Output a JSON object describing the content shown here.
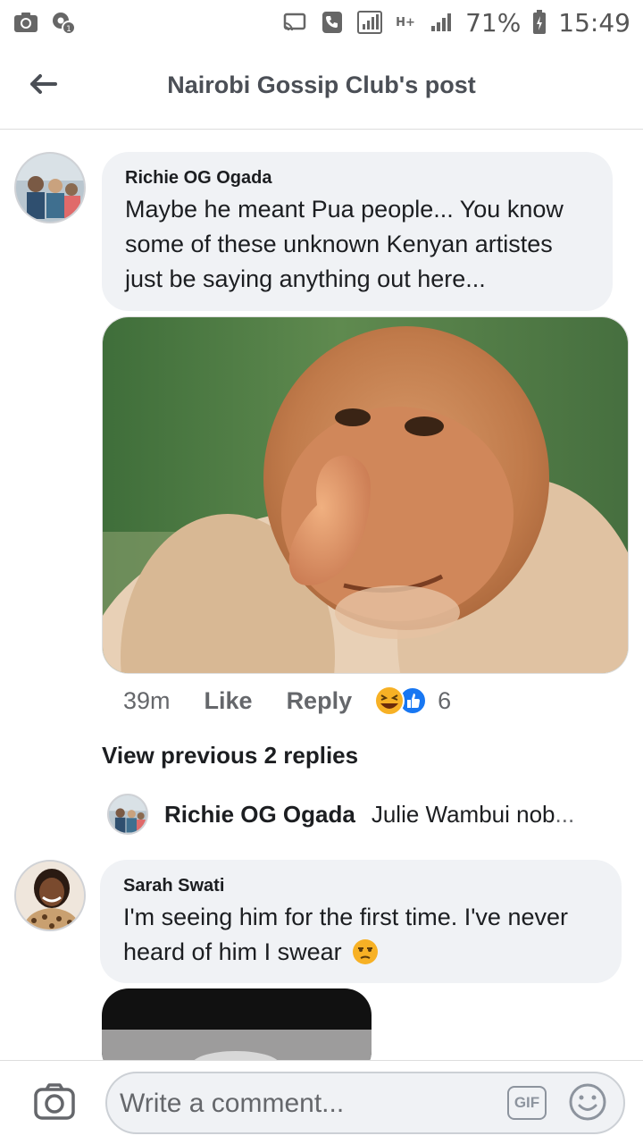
{
  "status_bar": {
    "battery_percent": "71%",
    "time": "15:49",
    "network_label": "H+"
  },
  "header": {
    "title": "Nairobi Gossip Club's post"
  },
  "comments": [
    {
      "author": "Richie OG Ogada",
      "text": "Maybe he meant Pua people... You know some of these unknown Kenyan artistes just be saying anything out here...",
      "time": "39m",
      "like_label": "Like",
      "reply_label": "Reply",
      "reaction_count": "6"
    },
    {
      "author": "Sarah Swati",
      "text": "I'm seeing him for the first time. I've never heard of him I swear"
    }
  ],
  "view_previous_label": "View previous 2 replies",
  "reply_preview": {
    "author": "Richie OG Ogada",
    "text": "Julie Wambui nob",
    "ellipsis": "..."
  },
  "composer": {
    "placeholder": "Write a comment...",
    "gif_label": "GIF"
  }
}
